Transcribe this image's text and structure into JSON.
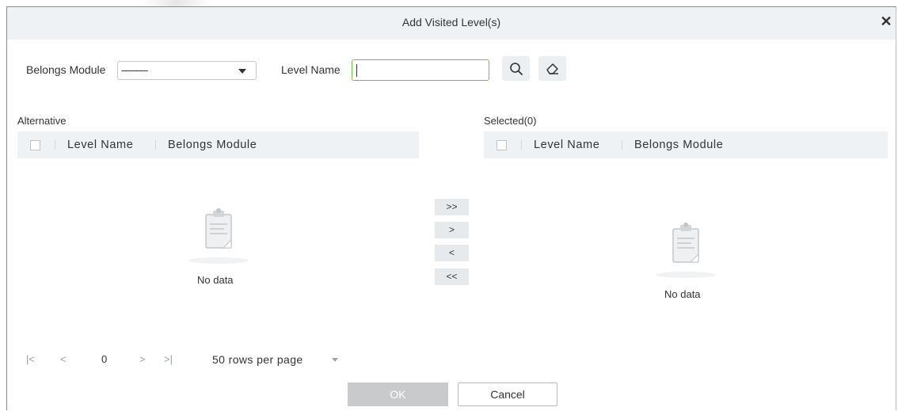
{
  "dialog": {
    "title": "Add Visited Level(s)",
    "close_icon": "close-icon"
  },
  "filters": {
    "belongs_module_label": "Belongs Module",
    "belongs_module_value": "----------",
    "level_name_label": "Level Name",
    "level_name_value": "",
    "search_icon": "search-icon",
    "clear_icon": "eraser-icon"
  },
  "alternative": {
    "title": "Alternative",
    "columns": [
      "Level Name",
      "Belongs Module"
    ],
    "empty_text": "No data"
  },
  "selected": {
    "title": "Selected(0)",
    "columns": [
      "Level Name",
      "Belongs Module"
    ],
    "empty_text": "No data"
  },
  "transfer": {
    "move_all_right": ">>",
    "move_right": ">",
    "move_left": "<",
    "move_all_left": "<<"
  },
  "pagination": {
    "first": "|<",
    "prev": "<",
    "page": "0",
    "next": ">",
    "last": ">|",
    "rows_per_page": "50 rows per page"
  },
  "footer": {
    "ok_label": "OK",
    "cancel_label": "Cancel"
  },
  "colors": {
    "title_bar_bg": "#eef2f5",
    "input_focus_border": "#7ac143",
    "ok_disabled_bg": "#c8cacc"
  }
}
